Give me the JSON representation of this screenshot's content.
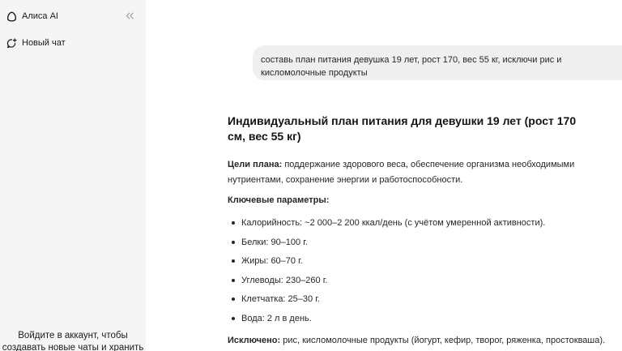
{
  "sidebar": {
    "brand_title": "Алиса AI",
    "new_chat_label": "Новый чат",
    "login_hint_line1": "Войдите в аккаунт, чтобы",
    "login_hint_line2": "создавать новые чаты и хранить"
  },
  "icons": {
    "brand": "alice-logo-icon",
    "collapse": "chevrons-left-icon",
    "new_chat": "new-chat-icon"
  },
  "chat": {
    "user_message": "составь план питания девушка 19 лет, рост 170, вес 55 кг, исключи рис и кисломолочные продукты",
    "answer": {
      "title": "Индивидуальный план питания для девушки 19 лет (рост 170 см, вес 55 кг)",
      "goals_label": "Цели плана:",
      "goals_text": " поддержание здорового веса, обеспечение организма необходимыми нутриентами, сохранение энергии и работоспособности.",
      "params_label": "Ключевые параметры:",
      "params": [
        "Калорийность: ~2 000–2 200 ккал/день (с учётом умеренной активности).",
        "Белки: 90–100 г.",
        "Жиры: 60–70 г.",
        "Углеводы: 230–260 г.",
        "Клетчатка: 25–30 г.",
        "Вода: 2 л в день."
      ],
      "excluded_label": "Исключено:",
      "excluded_text": " рис, кисломолочные продукты (йогурт, кефир, творог, ряженка, простокваша)."
    }
  }
}
